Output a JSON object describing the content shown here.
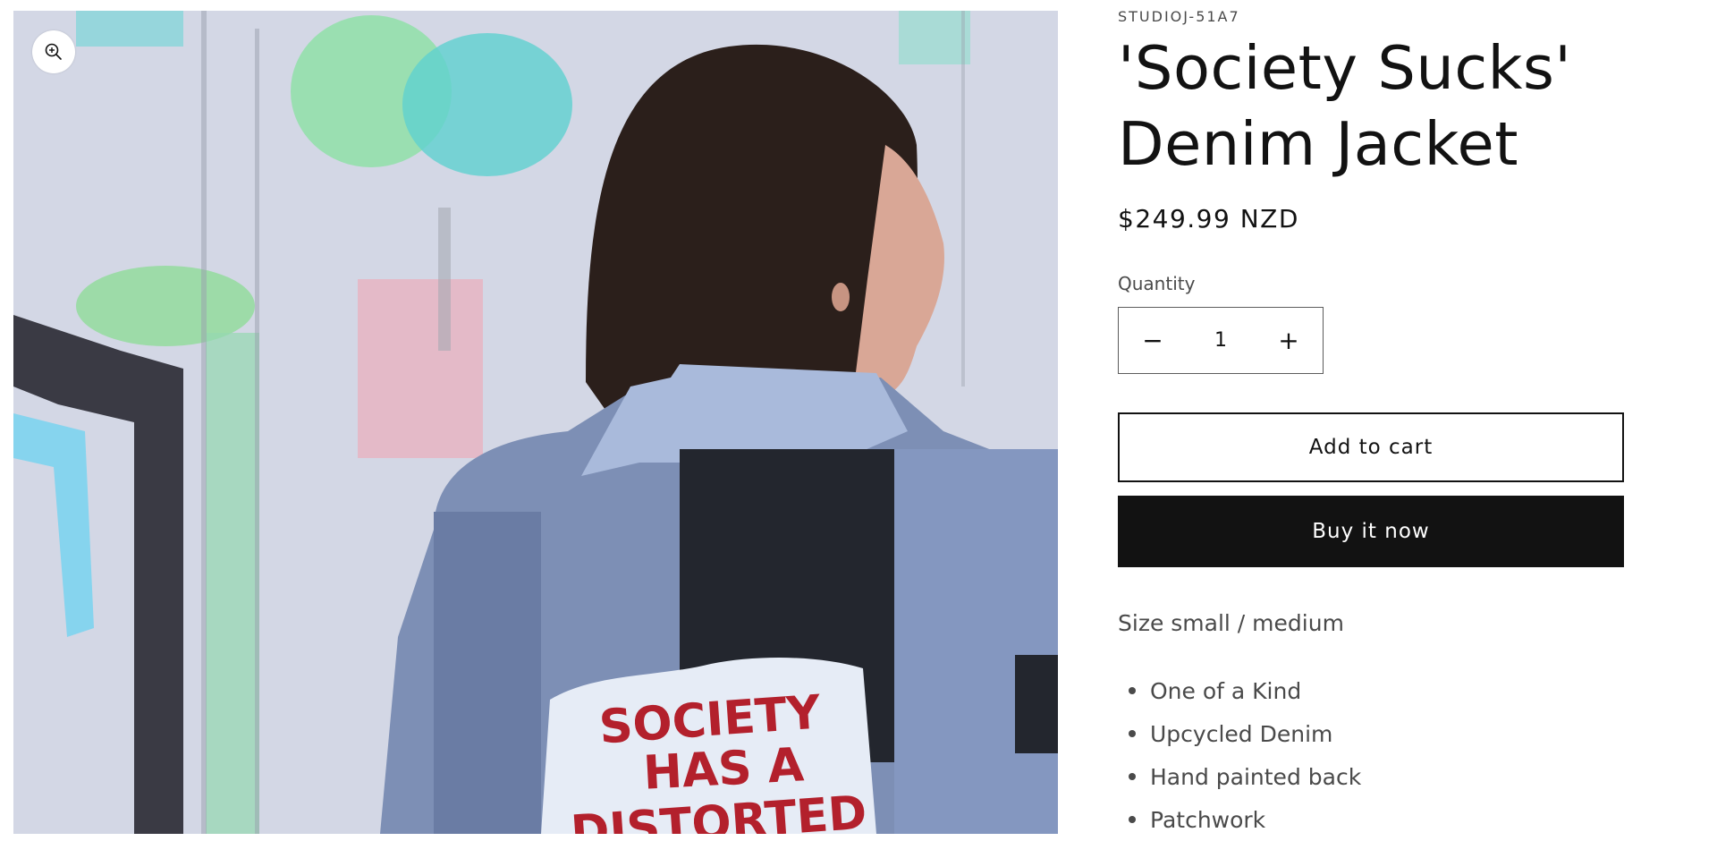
{
  "product": {
    "vendor": "STUDIOJ-51A7",
    "title": "'Society Sucks' Denim Jacket",
    "price": "$249.99 NZD",
    "image": {
      "alt": "Woman seen from behind wearing a patchwork denim jacket in front of a graffiti wall",
      "painted_text_lines": [
        "SOCIETY",
        "HAS A",
        "DISTORTED"
      ]
    }
  },
  "quantity": {
    "label": "Quantity",
    "value": "1",
    "decrease_symbol": "−",
    "increase_symbol": "+"
  },
  "actions": {
    "add_to_cart": "Add to cart",
    "buy_now": "Buy it now"
  },
  "description": {
    "size": "Size small / medium",
    "features": [
      "One of a Kind",
      "Upcycled Denim",
      "Hand painted back",
      "Patchwork"
    ]
  },
  "icons": {
    "zoom": "zoom-in-icon"
  },
  "colors": {
    "text": "#121212",
    "muted": "#4a4a4a",
    "buy_button_bg": "#121212",
    "buy_button_text": "#ffffff",
    "painted_text": "#b3202c"
  }
}
